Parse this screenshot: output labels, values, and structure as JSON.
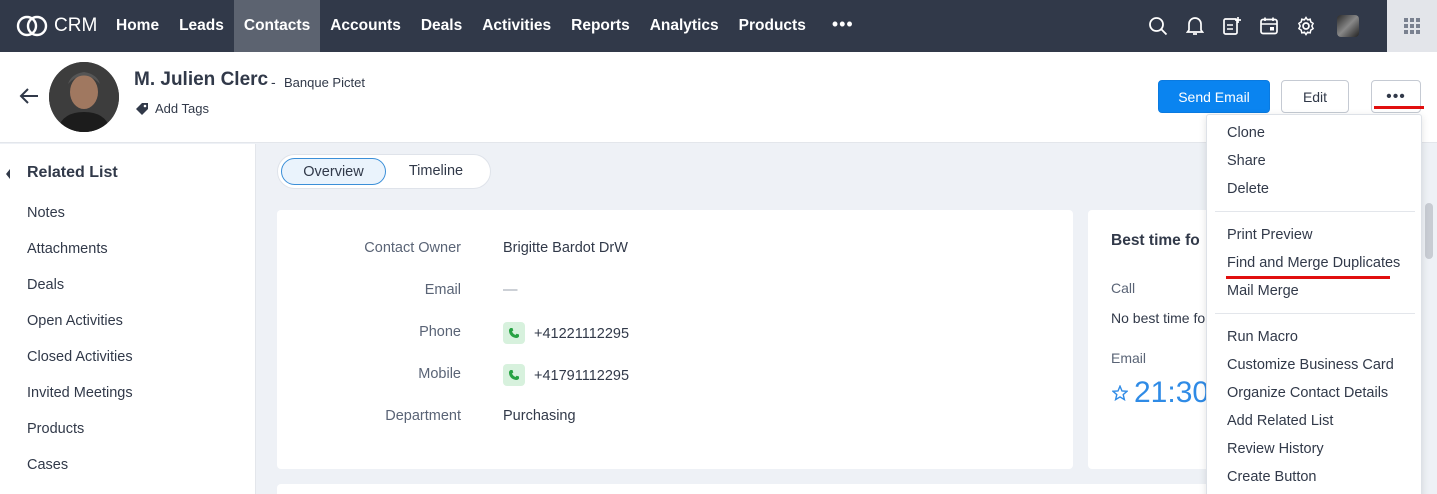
{
  "topbar": {
    "logo_text": "CRM",
    "nav": [
      "Home",
      "Leads",
      "Contacts",
      "Accounts",
      "Deals",
      "Activities",
      "Reports",
      "Analytics",
      "Products"
    ],
    "active_nav": "Contacts",
    "more_label": "•••",
    "icons": [
      "search-icon",
      "bell-icon",
      "add-note-icon",
      "calendar-icon",
      "gear-icon",
      "user-avatar",
      "apps-grid-icon"
    ]
  },
  "record": {
    "name": "M. Julien Clerc",
    "separator": "-",
    "company": "Banque Pictet",
    "add_tags": "Add Tags",
    "send_email": "Send Email",
    "edit": "Edit",
    "more": "•••"
  },
  "sidebar": {
    "title": "Related List",
    "items": [
      "Notes",
      "Attachments",
      "Deals",
      "Open Activities",
      "Closed Activities",
      "Invited Meetings",
      "Products",
      "Cases"
    ]
  },
  "tabs": [
    "Overview",
    "Timeline"
  ],
  "details": [
    {
      "label": "Contact Owner",
      "value": "Brigitte Bardot DrW"
    },
    {
      "label": "Email",
      "value": "—"
    },
    {
      "label": "Phone",
      "value": "+41221112295"
    },
    {
      "label": "Mobile",
      "value": "+41791112295"
    },
    {
      "label": "Department",
      "value": "Purchasing"
    }
  ],
  "best_time": {
    "title": "Best time fo",
    "call_label": "Call",
    "call_value": "No best time fo",
    "email_label": "Email",
    "email_time": "21:30"
  },
  "menu": {
    "group1": [
      "Clone",
      "Share",
      "Delete"
    ],
    "group2": [
      "Print Preview",
      "Find and Merge Duplicates",
      "Mail Merge"
    ],
    "group3": [
      "Run Macro",
      "Customize Business Card",
      "Organize Contact Details",
      "Add Related List",
      "Review History",
      "Create Button"
    ]
  },
  "colors": {
    "nav_bg": "#313949",
    "primary": "#0a84f0",
    "annotation": "#e10e0e",
    "phone_badge": "#d7f1dd"
  }
}
